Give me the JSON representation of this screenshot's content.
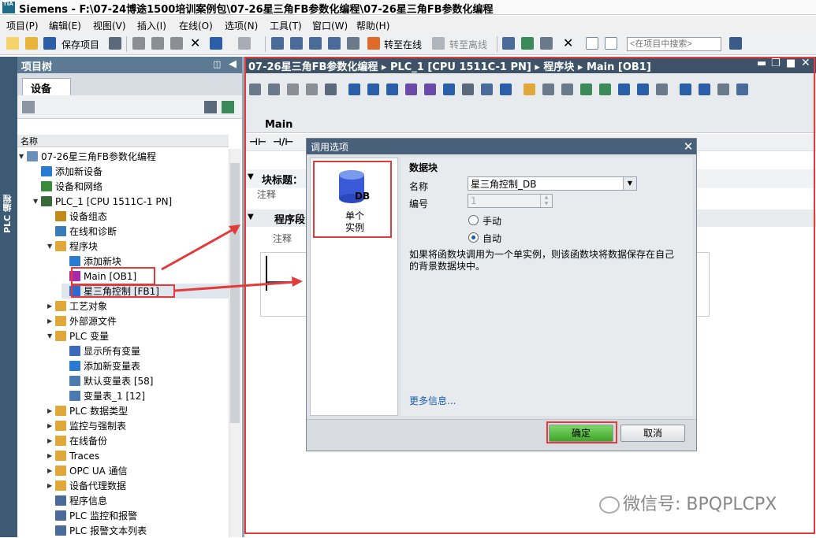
{
  "window": {
    "app_logo": "TIA",
    "title": "Siemens  -  F:\\07-24博途1500培训案例包\\07-26星三角FB参数化编程\\07-26星三角FB参数化编程"
  },
  "menubar": [
    "项目(P)",
    "编辑(E)",
    "视图(V)",
    "插入(I)",
    "在线(O)",
    "选项(N)",
    "工具(T)",
    "窗口(W)",
    "帮助(H)"
  ],
  "toolbar": {
    "save_label": "保存项目",
    "go_online": "转至在线",
    "go_offline": "转至离线",
    "search_placeholder": "<在项目中搜索>"
  },
  "side_strip_label": "PLC 编程",
  "project_tree": {
    "header": "项目树",
    "tab": "设备",
    "column_name": "名称",
    "items": [
      {
        "label": "07-26星三角FB参数化编程",
        "indent": 0,
        "expand": "▼",
        "icon": "project",
        "color": "#6a8fb8"
      },
      {
        "label": "添加新设备",
        "indent": 1,
        "expand": "",
        "icon": "add-device",
        "color": "#2b7ad1"
      },
      {
        "label": "设备和网络",
        "indent": 1,
        "expand": "",
        "icon": "network",
        "color": "#3b8a3b"
      },
      {
        "label": "PLC_1 [CPU 1511C-1 PN]",
        "indent": 1,
        "expand": "▼",
        "icon": "plc",
        "color": "#3a6a3a"
      },
      {
        "label": "设备组态",
        "indent": 2,
        "expand": "",
        "icon": "config",
        "color": "#c08a1a"
      },
      {
        "label": "在线和诊断",
        "indent": 2,
        "expand": "",
        "icon": "diagnostics",
        "color": "#3a7ab8"
      },
      {
        "label": "程序块",
        "indent": 2,
        "expand": "▼",
        "icon": "folder",
        "color": "#e0a83a"
      },
      {
        "label": "添加新块",
        "indent": 3,
        "expand": "",
        "icon": "add-block",
        "color": "#2b7ad1"
      },
      {
        "label": "Main [OB1]",
        "indent": 3,
        "expand": "",
        "icon": "ob",
        "color": "#a82aa8"
      },
      {
        "label": "星三角控制 [FB1]",
        "indent": 3,
        "expand": "",
        "icon": "fb",
        "color": "#2a6ad1"
      },
      {
        "label": "工艺对象",
        "indent": 2,
        "expand": "▶",
        "icon": "folder",
        "color": "#e0a83a"
      },
      {
        "label": "外部源文件",
        "indent": 2,
        "expand": "▶",
        "icon": "folder",
        "color": "#e0a83a"
      },
      {
        "label": "PLC 变量",
        "indent": 2,
        "expand": "▼",
        "icon": "folder",
        "color": "#e0a83a"
      },
      {
        "label": "显示所有变量",
        "indent": 3,
        "expand": "",
        "icon": "tags",
        "color": "#3a6ab8"
      },
      {
        "label": "添加新变量表",
        "indent": 3,
        "expand": "",
        "icon": "add-tags",
        "color": "#2b7ad1"
      },
      {
        "label": "默认变量表 [58]",
        "indent": 3,
        "expand": "",
        "icon": "tag-table",
        "color": "#4a7ab0"
      },
      {
        "label": "变量表_1 [12]",
        "indent": 3,
        "expand": "",
        "icon": "tag-table",
        "color": "#4a7ab0"
      },
      {
        "label": "PLC 数据类型",
        "indent": 2,
        "expand": "▶",
        "icon": "folder",
        "color": "#e0a83a"
      },
      {
        "label": "监控与强制表",
        "indent": 2,
        "expand": "▶",
        "icon": "folder",
        "color": "#e0a83a"
      },
      {
        "label": "在线备份",
        "indent": 2,
        "expand": "▶",
        "icon": "folder",
        "color": "#e0a83a"
      },
      {
        "label": "Traces",
        "indent": 2,
        "expand": "▶",
        "icon": "folder",
        "color": "#e0a83a"
      },
      {
        "label": "OPC UA 通信",
        "indent": 2,
        "expand": "▶",
        "icon": "folder",
        "color": "#e0a83a"
      },
      {
        "label": "设备代理数据",
        "indent": 2,
        "expand": "▶",
        "icon": "folder",
        "color": "#e0a83a"
      },
      {
        "label": "程序信息",
        "indent": 2,
        "expand": "",
        "icon": "info",
        "color": "#4a6a9a"
      },
      {
        "label": "PLC 监控和报警",
        "indent": 2,
        "expand": "",
        "icon": "alarm",
        "color": "#4a6a9a"
      },
      {
        "label": "PLC 报警文本列表",
        "indent": 2,
        "expand": "",
        "icon": "text-list",
        "color": "#4a6a9a"
      }
    ]
  },
  "editor": {
    "breadcrumb": "07-26星三角FB参数化编程  ▸  PLC_1 [CPU 1511C-1 PN]  ▸  程序块  ▸  Main [OB1]",
    "main_label": "Main",
    "block_title": "块标题：",
    "comment": "注释",
    "network": "程序段",
    "network_comment": "注释"
  },
  "dialog": {
    "title": "调用选项",
    "instance_option": "单个\n实例",
    "db_icon_text": "DB",
    "section_title": "数据块",
    "name_label": "名称",
    "name_value": "星三角控制_DB",
    "number_label": "编号",
    "number_value": "1",
    "manual_label": "手动",
    "auto_label": "自动",
    "description": "如果将函数块调用为一个单实例，则该函数块将数据保存在自己的背景数据块中。",
    "more_info": "更多信息...",
    "ok": "确定",
    "cancel": "取消"
  },
  "watermark": "微信号: BPQPLCPX",
  "colors": {
    "accent_red": "#e23b3b",
    "panel_header": "#5c7a93",
    "editor_header": "#3e5367",
    "ok_green": "#4fb53a"
  }
}
